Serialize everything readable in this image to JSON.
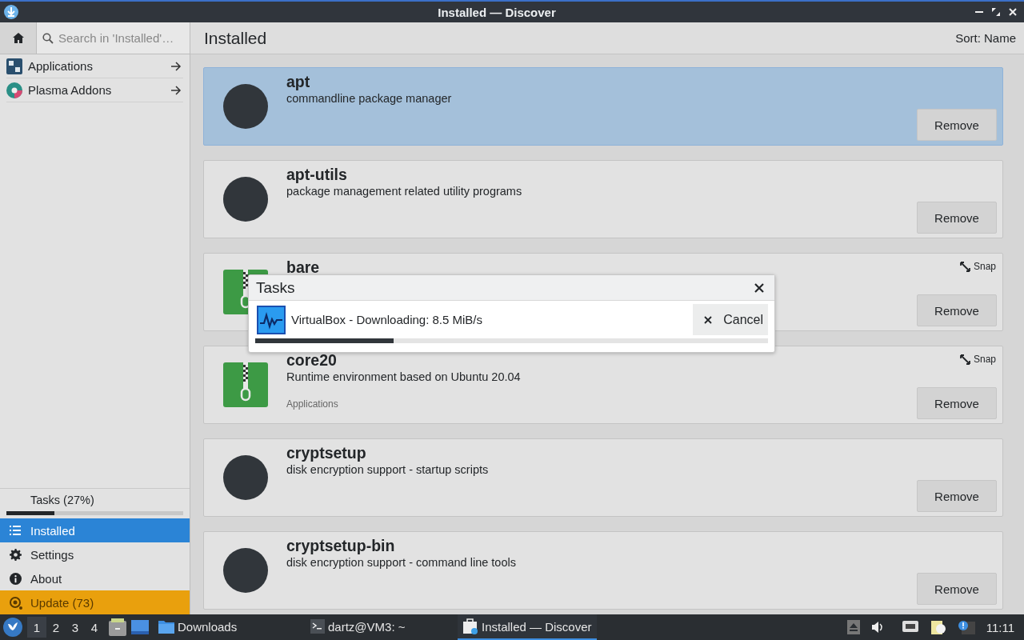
{
  "window": {
    "title": "Installed — Discover"
  },
  "search": {
    "placeholder": "Search in 'Installed'…"
  },
  "page": {
    "title": "Installed",
    "sort": "Sort: Name"
  },
  "categories": [
    {
      "label": "Applications",
      "kind": "apps"
    },
    {
      "label": "Plasma Addons",
      "kind": "addons"
    }
  ],
  "tasks_progress": {
    "label": "Tasks (27%)",
    "level": 0.27
  },
  "nav": [
    {
      "label": "Installed",
      "kind": "installed",
      "selected": true
    },
    {
      "label": "Settings",
      "kind": "settings",
      "selected": false
    },
    {
      "label": "About",
      "kind": "about",
      "selected": false
    },
    {
      "label": "Update (73)",
      "kind": "update",
      "selected": false
    }
  ],
  "packages": [
    {
      "name": "apt",
      "description": "commandline package manager",
      "kind": "generic",
      "selected": true,
      "button": "Remove"
    },
    {
      "name": "apt-utils",
      "description": "package management related utility programs",
      "kind": "generic",
      "selected": false,
      "button": "Remove"
    },
    {
      "name": "bare",
      "kind": "snap",
      "badge": "Snap",
      "selected": false,
      "button": "Remove"
    },
    {
      "name": "core20",
      "description": "Runtime environment based on Ubuntu 20.04",
      "category": "Applications",
      "kind": "snap",
      "badge": "Snap",
      "selected": false,
      "button": "Remove"
    },
    {
      "name": "cryptsetup",
      "description": "disk encryption support - startup scripts",
      "kind": "generic",
      "selected": false,
      "button": "Remove"
    },
    {
      "name": "cryptsetup-bin",
      "description": "disk encryption support - command line tools",
      "kind": "generic",
      "selected": false,
      "button": "Remove"
    }
  ],
  "tasks_dialog": {
    "title": "Tasks",
    "items": [
      {
        "label": "VirtualBox - Downloading: 8.5 MiB/s",
        "cancel": "Cancel",
        "level": 0.27
      }
    ]
  },
  "taskbar": {
    "desktops": [
      {
        "label": "1",
        "selected": true
      },
      {
        "label": "2",
        "selected": false
      },
      {
        "label": "3",
        "selected": false
      },
      {
        "label": "4",
        "selected": false
      }
    ],
    "windows": [
      {
        "label": "Downloads",
        "kind": "folder",
        "selected": false
      },
      {
        "label": "dartz@VM3: ~",
        "kind": "terminal",
        "selected": false
      },
      {
        "label": "Installed — Discover",
        "kind": "discover",
        "selected": true
      }
    ],
    "clock": "11:11"
  }
}
